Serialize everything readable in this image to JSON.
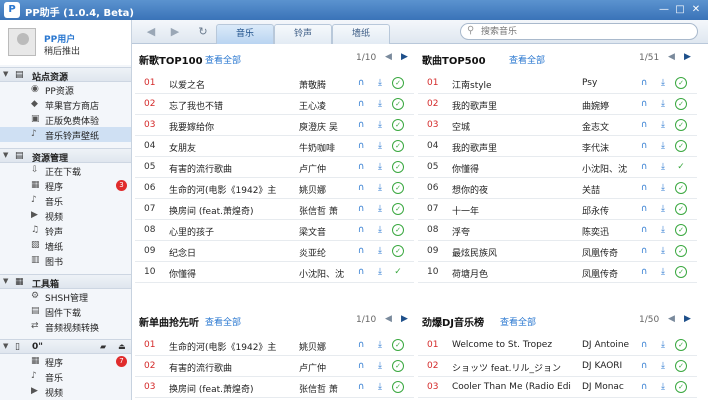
{
  "window": {
    "title": "PP助手 (1.0.4, Beta)",
    "logo": "P"
  },
  "toolbar": {
    "tabs": [
      {
        "label": "音乐"
      },
      {
        "label": "铃声"
      },
      {
        "label": "墙纸"
      }
    ],
    "active_tab": 0,
    "search_placeholder": "搜索音乐"
  },
  "profile": {
    "username": "PP用户",
    "logout": "稍后推出"
  },
  "sidebar": {
    "sections": [
      {
        "label": "站点资源",
        "items": [
          {
            "label": "PP资源"
          },
          {
            "label": "苹果官方商店"
          },
          {
            "label": "正版免费体验"
          },
          {
            "label": "音乐铃声壁纸",
            "selected": true
          }
        ]
      },
      {
        "label": "资源管理",
        "items": [
          {
            "label": "正在下载"
          },
          {
            "label": "程序",
            "badge": "3"
          },
          {
            "label": "音乐"
          },
          {
            "label": "视频"
          },
          {
            "label": "铃声"
          },
          {
            "label": "墙纸"
          },
          {
            "label": "图书"
          }
        ]
      },
      {
        "label": "工具箱",
        "items": [
          {
            "label": "SHSH管理"
          },
          {
            "label": "固件下载"
          },
          {
            "label": "音频视频转换"
          }
        ]
      },
      {
        "label": "0\"",
        "items": [
          {
            "label": "程序",
            "badge": "7"
          },
          {
            "label": "音乐"
          },
          {
            "label": "视频"
          }
        ]
      }
    ]
  },
  "panels": [
    {
      "title": "新歌TOP100",
      "view_all": "查看全部",
      "page": "1/10",
      "rows": [
        {
          "no": "01",
          "title": "以爱之名",
          "artist": "萧敬腾",
          "status": "circle"
        },
        {
          "no": "02",
          "title": "忘了我也不错",
          "artist": "王心凌",
          "status": "circle"
        },
        {
          "no": "03",
          "title": "我要嫁给你",
          "artist": "庾澄庆 吴",
          "status": "circle"
        },
        {
          "no": "04",
          "title": "女朋友",
          "artist": "牛奶咖啡",
          "status": "circle"
        },
        {
          "no": "05",
          "title": "有害的流行歌曲",
          "artist": "卢广仲",
          "status": "circle"
        },
        {
          "no": "06",
          "title": "生命的河(电影《1942》主",
          "artist": "姚贝娜",
          "status": "circle"
        },
        {
          "no": "07",
          "title": "换房间 (feat.萧煌奇)",
          "artist": "张信哲 萧",
          "status": "circle"
        },
        {
          "no": "08",
          "title": "心里的孩子",
          "artist": "梁文音",
          "status": "circle"
        },
        {
          "no": "09",
          "title": "纪念日",
          "artist": "炎亚纶",
          "status": "circle"
        },
        {
          "no": "10",
          "title": "你懂得",
          "artist": "小沈阳、沈",
          "status": "check"
        }
      ]
    },
    {
      "title": "歌曲TOP500",
      "view_all": "查看全部",
      "page": "1/51",
      "rows": [
        {
          "no": "01",
          "title": "江南style",
          "artist": "Psy",
          "status": "circle"
        },
        {
          "no": "02",
          "title": "我的歌声里",
          "artist": "曲婉婷",
          "status": "circle"
        },
        {
          "no": "03",
          "title": "空城",
          "artist": "金志文",
          "status": "circle"
        },
        {
          "no": "04",
          "title": "我的歌声里",
          "artist": "李代沫",
          "status": "circle"
        },
        {
          "no": "05",
          "title": "你懂得",
          "artist": "小沈阳、沈",
          "status": "check"
        },
        {
          "no": "06",
          "title": "想你的夜",
          "artist": "关喆",
          "status": "circle"
        },
        {
          "no": "07",
          "title": "十一年",
          "artist": "邱永传",
          "status": "circle"
        },
        {
          "no": "08",
          "title": "浮夸",
          "artist": "陈奕迅",
          "status": "circle"
        },
        {
          "no": "09",
          "title": "最炫民族风",
          "artist": "凤凰传奇",
          "status": "circle"
        },
        {
          "no": "10",
          "title": "荷塘月色",
          "artist": "凤凰传奇",
          "status": "circle"
        }
      ]
    },
    {
      "title": "新单曲抢先听",
      "view_all": "查看全部",
      "page": "1/10",
      "rows": [
        {
          "no": "01",
          "title": "生命的河(电影《1942》主",
          "artist": "姚贝娜",
          "status": "circle"
        },
        {
          "no": "02",
          "title": "有害的流行歌曲",
          "artist": "卢广仲",
          "status": "circle"
        },
        {
          "no": "03",
          "title": "换房间 (feat.萧煌奇)",
          "artist": "张信哲 萧",
          "status": "circle"
        }
      ]
    },
    {
      "title": "劲爆DJ音乐榜",
      "view_all": "查看全部",
      "page": "1/50",
      "rows": [
        {
          "no": "01",
          "title": "Welcome to St. Tropez",
          "artist": "DJ Antoine",
          "status": "circle"
        },
        {
          "no": "02",
          "title": "ショッツ feat.リル_ジョン",
          "artist": "DJ KAORI",
          "status": "circle"
        },
        {
          "no": "03",
          "title": "Cooler Than Me (Radio Edi",
          "artist": "DJ Monac",
          "status": "circle"
        }
      ]
    }
  ],
  "colors": {
    "accent": "#2b78d0",
    "titlebar": "#3a73b8",
    "number_red": "#d42a2a",
    "ok_green": "#3aa840"
  }
}
